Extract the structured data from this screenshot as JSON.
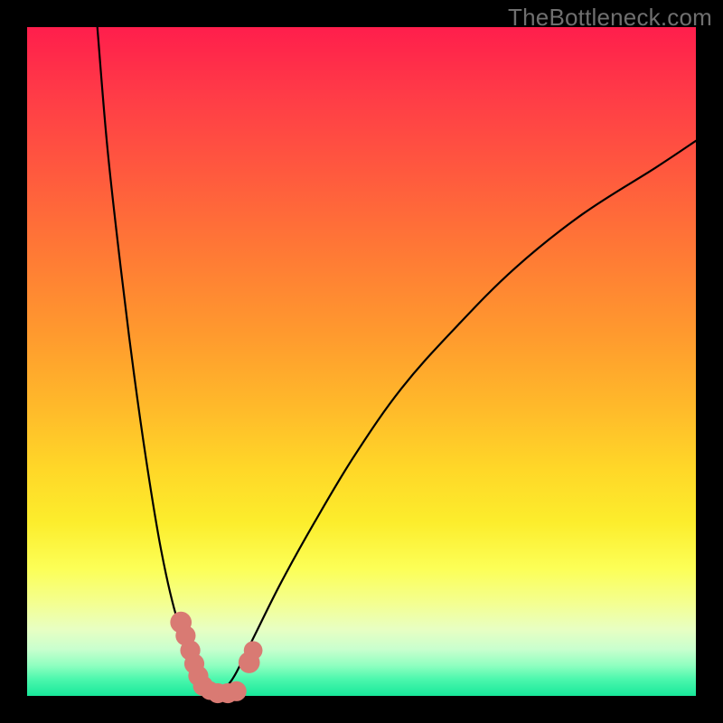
{
  "watermark": "TheBottleneck.com",
  "colors": {
    "curve_stroke": "#000000",
    "marker_fill": "#d97a73",
    "marker_stroke": "#d97a73"
  },
  "chart_data": {
    "type": "line",
    "title": "",
    "xlabel": "",
    "ylabel": "",
    "xlim": [
      0,
      100
    ],
    "ylim": [
      0,
      100
    ],
    "grid": false,
    "note": "Y increases downward in drawing; values below are in percent of plot area (0=left/top, 100=right/bottom). Two curves form a V shape; markers cluster near the trough.",
    "series": [
      {
        "name": "left-curve",
        "x": [
          10.5,
          12,
          14,
          16,
          18,
          20,
          22,
          24,
          25.5,
          27,
          29
        ],
        "y": [
          0,
          18,
          36,
          52,
          66,
          78,
          87,
          93,
          96.5,
          98.5,
          99.6
        ]
      },
      {
        "name": "right-curve",
        "x": [
          29,
          31,
          34,
          38,
          43,
          49,
          56,
          64,
          73,
          83,
          94,
          100
        ],
        "y": [
          99.6,
          97,
          91,
          83,
          74,
          64,
          54,
          45,
          36,
          28,
          21,
          17
        ]
      }
    ],
    "markers": [
      {
        "x": 23.0,
        "y": 89.0,
        "r": 1.6
      },
      {
        "x": 23.7,
        "y": 91.0,
        "r": 1.5
      },
      {
        "x": 24.4,
        "y": 93.2,
        "r": 1.5
      },
      {
        "x": 25.0,
        "y": 95.2,
        "r": 1.5
      },
      {
        "x": 25.6,
        "y": 97.0,
        "r": 1.5
      },
      {
        "x": 26.3,
        "y": 98.5,
        "r": 1.5
      },
      {
        "x": 27.3,
        "y": 99.2,
        "r": 1.4
      },
      {
        "x": 28.5,
        "y": 99.6,
        "r": 1.5
      },
      {
        "x": 30.0,
        "y": 99.6,
        "r": 1.5
      },
      {
        "x": 31.3,
        "y": 99.3,
        "r": 1.5
      },
      {
        "x": 33.2,
        "y": 95.0,
        "r": 1.6
      },
      {
        "x": 33.8,
        "y": 93.2,
        "r": 1.4
      }
    ]
  }
}
